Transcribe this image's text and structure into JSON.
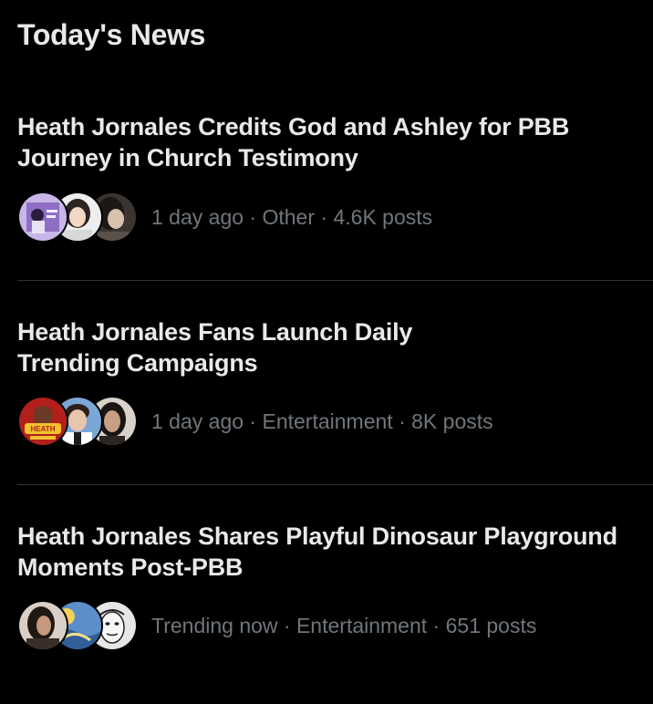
{
  "section": {
    "title": "Today's News"
  },
  "news": [
    {
      "headline": "Heath Jornales Credits God and Ashley for PBB Journey in Church Testimony",
      "time": "1 day ago",
      "category": "Other",
      "posts": "4.6K posts",
      "separator": " · "
    },
    {
      "headline": "Heath Jornales Fans Launch Daily Trending Campaigns",
      "time": "1 day ago",
      "category": "Entertainment",
      "posts": "8K posts",
      "separator": " · "
    },
    {
      "headline": "Heath Jornales Shares Playful Dinosaur Playground Moments Post-PBB",
      "time": "Trending now",
      "category": "Entertainment",
      "posts": "651 posts",
      "separator": " · "
    }
  ],
  "colors": {
    "background": "#000000",
    "primary_text": "#e7e9ea",
    "secondary_text": "#71767b",
    "divider": "#2f3336"
  }
}
